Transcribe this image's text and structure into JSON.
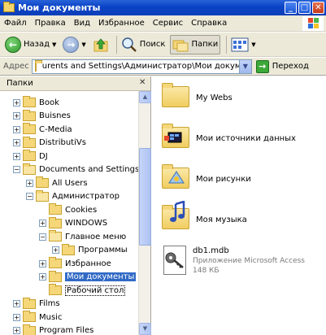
{
  "window": {
    "title": "Мои документы",
    "buttons": {
      "minimize": "_",
      "maximize": "□",
      "close": "✕"
    }
  },
  "menu": [
    "Файл",
    "Правка",
    "Вид",
    "Избранное",
    "Сервис",
    "Справка"
  ],
  "toolbar": {
    "back": "Назад",
    "search": "Поиск",
    "folders": "Папки"
  },
  "address": {
    "label": "Адрес",
    "value": "urents and Settings\\Администратор\\Мои документы",
    "go": "Переход"
  },
  "folders_pane": {
    "title": "Папки",
    "items": [
      {
        "label": "Book",
        "expander": "+",
        "depth": 0
      },
      {
        "label": "Buisnes",
        "expander": "+",
        "depth": 0
      },
      {
        "label": "C-Media",
        "expander": "+",
        "depth": 0
      },
      {
        "label": "DistributiVs",
        "expander": "+",
        "depth": 0
      },
      {
        "label": "DJ",
        "expander": "+",
        "depth": 0
      },
      {
        "label": "Documents and Settings",
        "expander": "−",
        "depth": 0
      },
      {
        "label": "All Users",
        "expander": "+",
        "depth": 1
      },
      {
        "label": "Администратор",
        "expander": "−",
        "depth": 1
      },
      {
        "label": "Cookies",
        "expander": "",
        "depth": 2
      },
      {
        "label": "WINDOWS",
        "expander": "+",
        "depth": 2
      },
      {
        "label": "Главное меню",
        "expander": "−",
        "depth": 2
      },
      {
        "label": "Программы",
        "expander": "+",
        "depth": 3
      },
      {
        "label": "Избранное",
        "expander": "+",
        "depth": 2
      },
      {
        "label": "Мои документы",
        "expander": "+",
        "depth": 2
      },
      {
        "label": "Рабочий стол",
        "expander": "",
        "depth": 2
      },
      {
        "label": "Films",
        "expander": "+",
        "depth": 0
      },
      {
        "label": "Music",
        "expander": "+",
        "depth": 0
      },
      {
        "label": "Program Files",
        "expander": "+",
        "depth": 0
      }
    ]
  },
  "content": {
    "items": [
      {
        "name": "My Webs",
        "icon": "folder-icon"
      },
      {
        "name": "Мои источники данных",
        "icon": "data-sources-folder-icon"
      },
      {
        "name": "Мои рисунки",
        "icon": "pictures-folder-icon"
      },
      {
        "name": "Моя музыка",
        "icon": "music-folder-icon"
      },
      {
        "name": "db1.mdb",
        "type": "Приложение Microsoft Access",
        "size": "148 КБ",
        "icon": "access-file-icon"
      }
    ]
  }
}
